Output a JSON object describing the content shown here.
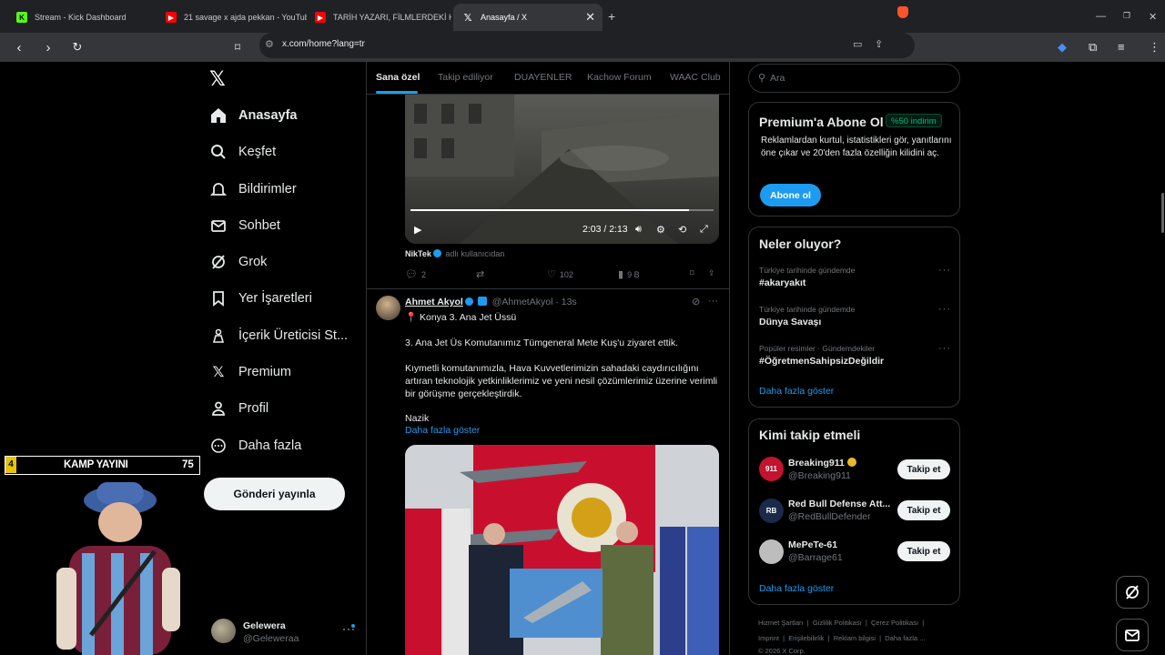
{
  "browser": {
    "tabs": [
      {
        "title": "Stream - Kick Dashboard",
        "icon": "kick-icon",
        "active": false
      },
      {
        "title": "21 savage x ajda pekkan - YouTube",
        "icon": "youtube-icon",
        "active": false
      },
      {
        "title": "TARİH YAZARI, FİLMLERDEKİ HİTLER",
        "icon": "youtube-icon",
        "active": false
      },
      {
        "title": "Anasayfa / X",
        "icon": "x-icon",
        "active": true
      }
    ],
    "url": "x.com/home?lang=tr"
  },
  "sidebar": {
    "items": [
      {
        "label": "Anasayfa",
        "icon": "home-icon"
      },
      {
        "label": "Keşfet",
        "icon": "search-icon"
      },
      {
        "label": "Bildirimler",
        "icon": "bell-icon"
      },
      {
        "label": "Sohbet",
        "icon": "mail-icon"
      },
      {
        "label": "Grok",
        "icon": "grok-icon"
      },
      {
        "label": "Yer İşaretleri",
        "icon": "bookmark-icon"
      },
      {
        "label": "İçerik Üreticisi St...",
        "icon": "creator-icon"
      },
      {
        "label": "Premium",
        "icon": "x-icon"
      },
      {
        "label": "Profil",
        "icon": "person-icon"
      },
      {
        "label": "Daha fazla",
        "icon": "more-circle-icon"
      }
    ],
    "post_button": "Gönderi yayınla",
    "account": {
      "name": "Gelewera",
      "handle": "@Geleweraa"
    }
  },
  "overlay": {
    "banner_left": "4",
    "banner_text": "KAMP YAYINI",
    "banner_right": "75"
  },
  "timeline": {
    "tabs": [
      "Sana özel",
      "Takip ediliyor",
      "DUAYENLER",
      "Kachow Forum",
      "WAAC Club"
    ],
    "video": {
      "time": "2:03 / 2:13",
      "progress": 0.92
    },
    "source": {
      "name": "NikTek",
      "text": "adlı kullanıcıdan"
    },
    "actions": {
      "replies": "2",
      "reposts": "",
      "likes": "102",
      "views": "9 B"
    },
    "tweet": {
      "name": "Ahmet Akyol",
      "handle": "@AhmetAkyol",
      "time": "13s",
      "line1": "📍 Konya 3. Ana Jet Üssü",
      "line2": "3. Ana Jet Üs Komutanımız Tümgeneral Mete Kuş'u ziyaret ettik.",
      "line3a": "Kıymetli komutanımızla, Hava Kuvvetlerimizin sahadaki caydırıcılığını",
      "line3b": "artıran teknolojik yetkinliklerimiz ve yeni nesil çözümlerimiz üzerine verimli",
      "line3c": "bir görüşme gerçekleştirdik.",
      "line4": "Nazik",
      "show_more": "Daha fazla göster"
    }
  },
  "right": {
    "search_placeholder": "Ara",
    "premium": {
      "title": "Premium'a Abone Ol",
      "badge": "%50 indirim",
      "body": "Reklamlardan kurtul, istatistikleri gör, yanıtlarını öne çıkar ve 20'den fazla özelliğin kilidini aç.",
      "button": "Abone ol"
    },
    "trends": {
      "title": "Neler oluyor?",
      "items": [
        {
          "context": "Türkiye tarihinde gündemde",
          "name": "#akaryakıt"
        },
        {
          "context": "Türkiye tarihinde gündemde",
          "name": "Dünya Savaşı"
        },
        {
          "context": "Popüler resimler · Gündemdekiler",
          "name": "#ÖğretmenSahipsizDeğildir"
        }
      ],
      "show_more": "Daha fazla göster"
    },
    "who_to_follow": {
      "title": "Kimi takip etmeli",
      "items": [
        {
          "name": "Breaking911",
          "handle": "@Breaking911",
          "button": "Takip et"
        },
        {
          "name": "Red Bull Defense Att...",
          "handle": "@RedBullDefender",
          "button": "Takip et"
        },
        {
          "name": "MePeTe-61",
          "handle": "@Barrage61",
          "button": "Takip et"
        }
      ],
      "show_more": "Daha fazla göster"
    },
    "footer": {
      "line1": [
        "Hizmet Şartları",
        "Gizlilik Politikası",
        "Çerez Politikası"
      ],
      "line2": [
        "Imprint",
        "Erişilebilirlik",
        "Reklam bilgisi",
        "Daha fazla ..."
      ],
      "copyright": "© 2026 X Corp."
    }
  }
}
